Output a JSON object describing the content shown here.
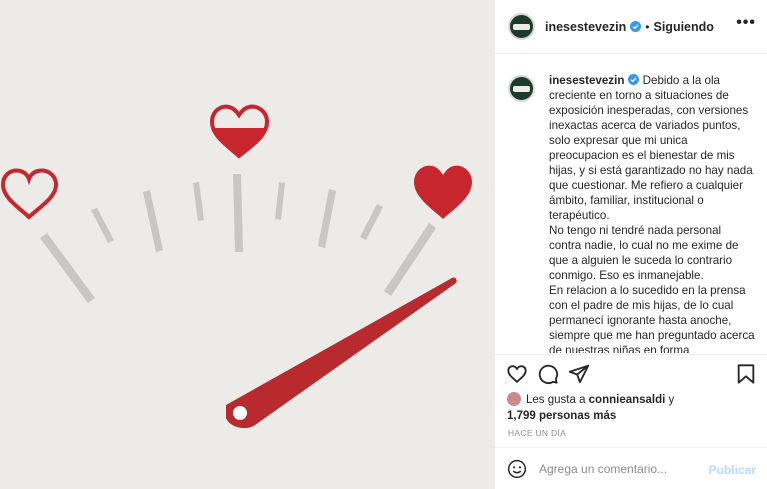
{
  "header": {
    "username": "inesestevezin",
    "separator": "•",
    "follow_label": "Siguiendo",
    "more_label": "•••"
  },
  "caption": {
    "username": "inesestevezin",
    "text": "Debido a la ola creciente en torno a situaciones de exposición inesperadas, con versiones inexactas acerca de variados puntos, solo expresar que mi unica preocupacion es el bienestar de mis hijas, y si está garantizado no hay nada que cuestionar. Me refiero a cualquier ámbito, familiar, institucional o terapéutico.\nNo tengo ni tendré nada personal contra nadie, lo cual no me exime de que a alguien le suceda lo contrario conmigo. Eso es inmanejable.\nEn relacion a lo sucedido en la prensa con el padre de mis hijas, de lo cual permanecí ignorante hasta anoche, siempre que me han preguntado acerca de nuestras niñas en forma"
  },
  "likes": {
    "prefix": "Les gusta a ",
    "user": "connieansaldi",
    "mid": " y",
    "count": "1,799 personas más"
  },
  "timestamp": "HACE UN DÍA",
  "comment": {
    "placeholder": "Agrega un comentario...",
    "publish_label": "Publicar"
  },
  "colors": {
    "heart_red": "#c8262e",
    "needle_red": "#b82a2e",
    "tick_gray": "#c8c7c1",
    "background": "#ecebe7",
    "verified_blue": "#3897f0",
    "publish_blue": "#b3dbff"
  },
  "icons": [
    "heart-icon",
    "comment-icon",
    "share-icon",
    "bookmark-icon",
    "emoji-icon",
    "verified-icon",
    "more-icon"
  ]
}
